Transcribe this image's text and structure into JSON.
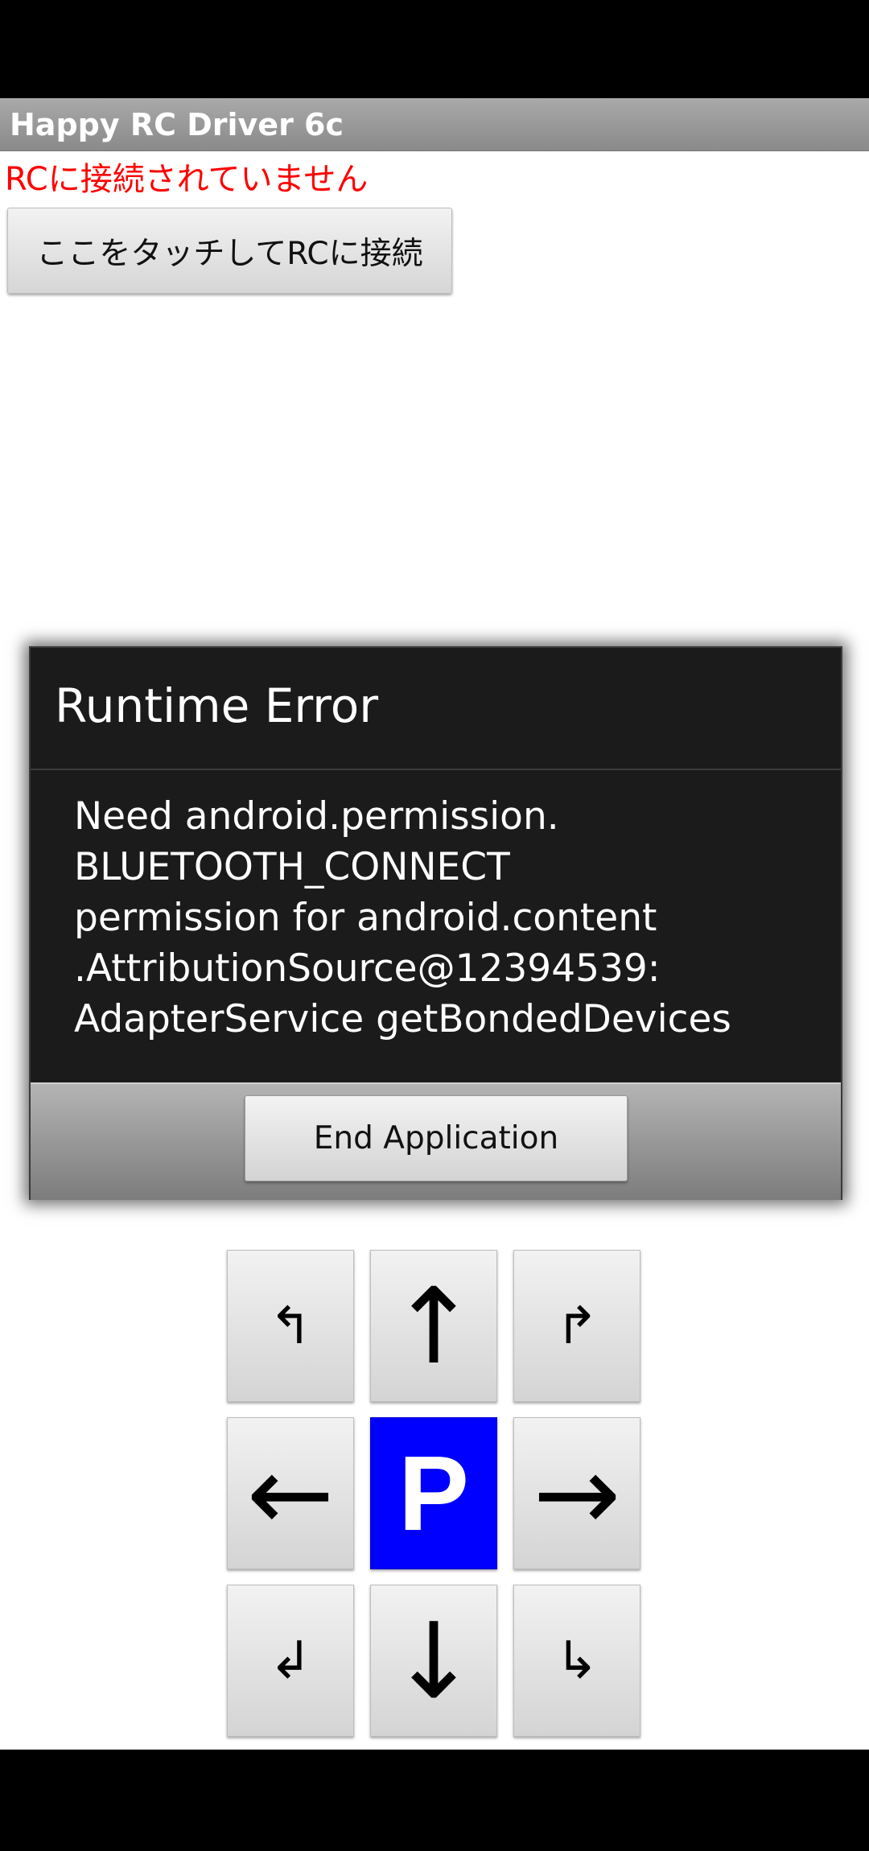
{
  "app": {
    "title": "Happy RC Driver 6c"
  },
  "connection": {
    "status_text": "RCに接続されていません",
    "status_color": "#ff0000",
    "connect_button_label": "ここをタッチしてRCに接続"
  },
  "dialog": {
    "title": "Runtime Error",
    "message_lines": [
      "Need android.permission.",
      "BLUETOOTH_CONNECT",
      "permission for android.content",
      ".AttributionSource@12394539:",
      "AdapterService getBondedDevices"
    ],
    "end_button_label": "End Application"
  },
  "dpad": {
    "buttons": [
      {
        "name": "forward-left-button",
        "icon_name": "turn-up-left-icon",
        "glyph": "↰"
      },
      {
        "name": "forward-button",
        "icon_name": "arrow-up-icon",
        "glyph": "↑"
      },
      {
        "name": "forward-right-button",
        "icon_name": "turn-up-right-icon",
        "glyph": "↱"
      },
      {
        "name": "left-button",
        "icon_name": "arrow-left-icon",
        "glyph": "←"
      },
      {
        "name": "park-button",
        "icon_name": "park-icon",
        "glyph": "P",
        "color": "#0000ff"
      },
      {
        "name": "right-button",
        "icon_name": "arrow-right-icon",
        "glyph": "→"
      },
      {
        "name": "back-left-button",
        "icon_name": "turn-down-left-icon",
        "glyph": "↲"
      },
      {
        "name": "back-button",
        "icon_name": "arrow-down-icon",
        "glyph": "↓"
      },
      {
        "name": "back-right-button",
        "icon_name": "turn-down-right-icon",
        "glyph": "↳"
      }
    ]
  }
}
